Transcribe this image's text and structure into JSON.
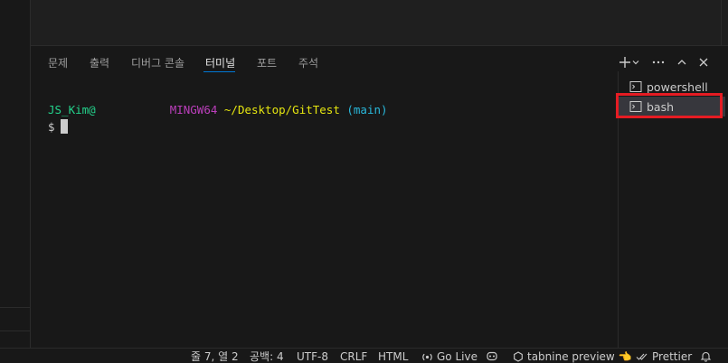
{
  "panel": {
    "tabs": [
      {
        "label": "문제"
      },
      {
        "label": "출력"
      },
      {
        "label": "디버그 콘솔"
      },
      {
        "label": "터미널"
      },
      {
        "label": "포트"
      },
      {
        "label": "주석"
      }
    ],
    "active_tab": "터미널"
  },
  "terminal": {
    "user": "JS_Kim@",
    "host_hidden": "",
    "system": "MINGW64",
    "path": "~/Desktop/GitTest",
    "branch": "(main)",
    "prompt": "$"
  },
  "terminal_list": [
    {
      "label": "powershell",
      "icon": "terminal-icon"
    },
    {
      "label": "bash",
      "icon": "terminal-icon",
      "selected": true
    }
  ],
  "statusbar": {
    "position": "줄 7, 열 2",
    "spaces": "공백: 4",
    "encoding": "UTF-8",
    "eol": "CRLF",
    "language": "HTML",
    "golive": "Go Live",
    "tabnine": "tabnine preview",
    "prettier": "Prettier"
  },
  "colors": {
    "accent": "#0078d4",
    "highlight_box": "#e51c23"
  }
}
